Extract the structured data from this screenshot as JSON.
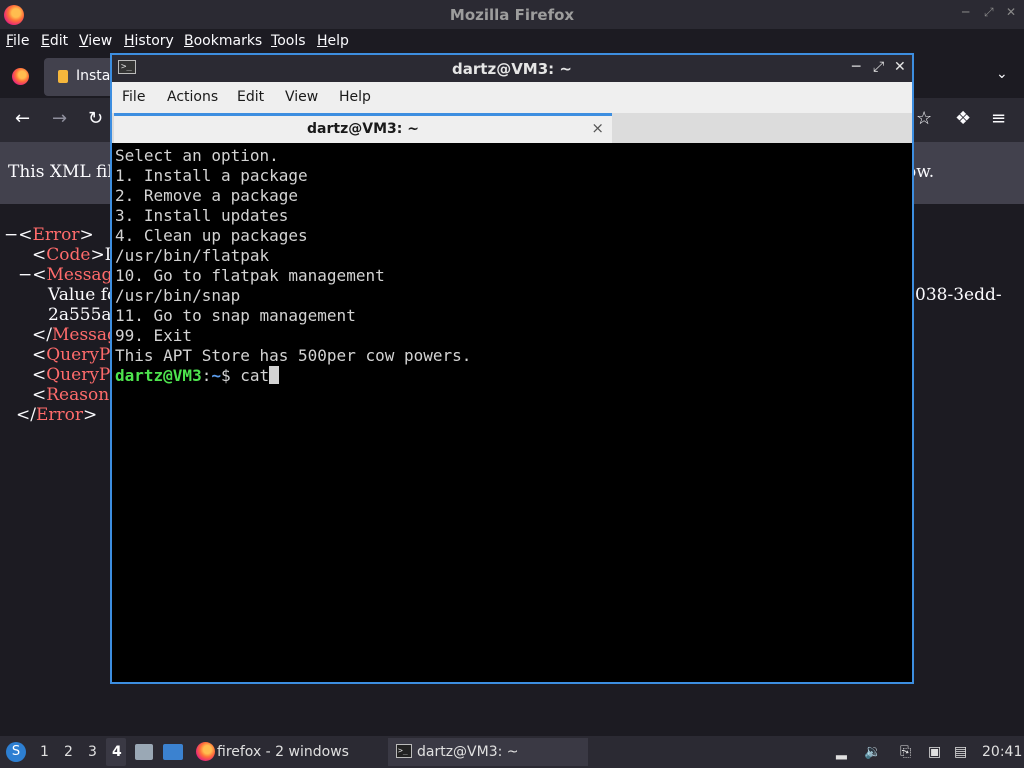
{
  "firefox": {
    "window_title": "Mozilla Firefox",
    "menu": [
      "File",
      "Edit",
      "View",
      "History",
      "Bookmarks",
      "Tools",
      "Help"
    ],
    "tab_label": "Insta",
    "notice_left": "This XML file",
    "notice_right": "ow.",
    "xml": {
      "l1_pre": "−<",
      "l1_tag": "Error",
      "l1_post": ">",
      "l2_pre": "<",
      "l2_tag": "Code",
      "l2_post": ">I",
      "l3_pre": "−<",
      "l3_tag": "Messag",
      "l4": "Value fo",
      "l4_right": "038-3edd-",
      "l5": "2a555a",
      "l6_pre": "</",
      "l6_tag": "Messag",
      "l7_pre": "<",
      "l7_tag": "QueryP",
      "l8_pre": "<",
      "l8_tag": "QueryP",
      "l9_pre": "<",
      "l9_tag": "Reason",
      "l10_pre": "</",
      "l10_tag": "Error",
      "l10_post": ">"
    }
  },
  "terminal": {
    "title": "dartz@VM3: ~",
    "icon_glyph": ">_",
    "menu": [
      "File",
      "Actions",
      "Edit",
      "View",
      "Help"
    ],
    "tab_label": "dartz@VM3: ~",
    "tab_close": "×",
    "lines": [
      "Select an option.",
      "1. Install a package",
      "2. Remove a package",
      "3. Install updates",
      "4. Clean up packages",
      "/usr/bin/flatpak",
      "10. Go to flatpak management",
      "/usr/bin/snap",
      "11. Go to snap management",
      "99. Exit",
      "This APT Store has 500per cow powers."
    ],
    "prompt_user": "dartz@VM3",
    "prompt_sep": ":",
    "prompt_path": "~",
    "prompt_symbol": "$ ",
    "command": "cat"
  },
  "taskbar": {
    "start_glyph": "S",
    "workspaces": [
      "1",
      "2",
      "3",
      "4"
    ],
    "active_workspace": "4",
    "firefox_task": "firefox - 2 windows",
    "terminal_task": "dartz@VM3: ~",
    "clock": "20:41"
  },
  "colors": {
    "accent": "#3d8ee0",
    "prompt_user": "#4ee44e",
    "prompt_path": "#5c9ded",
    "xml_tag": "#ff6b6b"
  }
}
